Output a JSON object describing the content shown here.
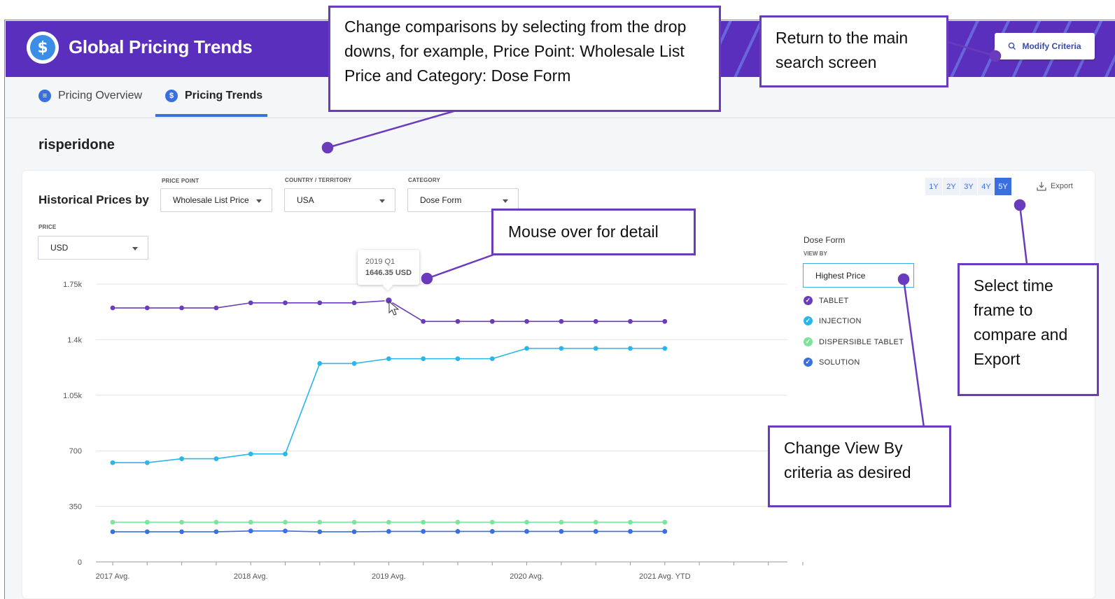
{
  "app": {
    "title": "Global Pricing Trends",
    "modify_label": "Modify Criteria"
  },
  "tabs": [
    {
      "label": "Pricing Overview",
      "active": false
    },
    {
      "label": "Pricing Trends",
      "active": true
    }
  ],
  "drug_name": "risperidone",
  "filters": {
    "heading": "Historical Prices by",
    "price_point": {
      "label": "PRICE POINT",
      "value": "Wholesale List Price"
    },
    "country": {
      "label": "COUNTRY / TERRITORY",
      "value": "USA"
    },
    "category": {
      "label": "CATEGORY",
      "value": "Dose Form"
    },
    "price": {
      "label": "PRICE",
      "value": "USD"
    }
  },
  "timeframes": [
    "1Y",
    "2Y",
    "3Y",
    "4Y",
    "5Y"
  ],
  "timeframe_selected": "5Y",
  "export_label": "Export",
  "legend": {
    "title": "Dose Form",
    "view_by_label": "VIEW BY",
    "view_by_value": "Highest Price",
    "items": [
      {
        "label": "TABLET",
        "color": "#6a3bbd"
      },
      {
        "label": "INJECTION",
        "color": "#29b6e8"
      },
      {
        "label": "DISPERSIBLE TABLET",
        "color": "#7fe39a"
      },
      {
        "label": "SOLUTION",
        "color": "#3a6fe0"
      }
    ]
  },
  "tooltip": {
    "period": "2019 Q1",
    "value": "1646.35 USD"
  },
  "callouts": {
    "dropdowns": "Change comparisons by selecting from the drop downs, for example, Price Point: Wholesale List Price and Category: Dose Form",
    "return": "Return to the main search screen",
    "mouseover": "Mouse over for detail",
    "timeframe": "Select time frame to compare and Export",
    "viewby": "Change View By criteria as desired"
  },
  "chart_data": {
    "type": "line",
    "ylim": [
      0,
      1750
    ],
    "y_ticks": [
      0,
      350,
      700,
      1050,
      1400,
      1750
    ],
    "y_tick_labels": [
      "0",
      "350",
      "700",
      "1.05k",
      "1.4k",
      "1.75k"
    ],
    "x_tick_labels": [
      "2017 Avg.",
      "2018 Avg.",
      "2019 Avg.",
      "2020 Avg.",
      "2021 Avg. YTD"
    ],
    "x_tick_label_indices": [
      0,
      4,
      8,
      12,
      16
    ],
    "n_points": 17,
    "n_ticks": 21,
    "series": [
      {
        "name": "TABLET",
        "color": "#6a3bbd",
        "values": [
          1600,
          1600,
          1600,
          1600,
          1632,
          1632,
          1632,
          1632,
          1646.35,
          1515,
          1515,
          1515,
          1515,
          1515,
          1515,
          1515,
          1515
        ]
      },
      {
        "name": "INJECTION",
        "color": "#29b6e8",
        "values": [
          625,
          625,
          650,
          650,
          680,
          680,
          1250,
          1250,
          1280,
          1280,
          1280,
          1280,
          1345,
          1345,
          1345,
          1345,
          1345
        ]
      },
      {
        "name": "DISPERSIBLE TABLET",
        "color": "#7fe39a",
        "values": [
          250,
          250,
          250,
          250,
          250,
          250,
          250,
          250,
          250,
          250,
          250,
          250,
          250,
          250,
          250,
          250,
          250
        ]
      },
      {
        "name": "SOLUTION",
        "color": "#3a6fe0",
        "values": [
          190,
          190,
          190,
          190,
          195,
          195,
          190,
          190,
          192,
          192,
          192,
          192,
          192,
          192,
          192,
          192,
          192
        ]
      }
    ]
  }
}
